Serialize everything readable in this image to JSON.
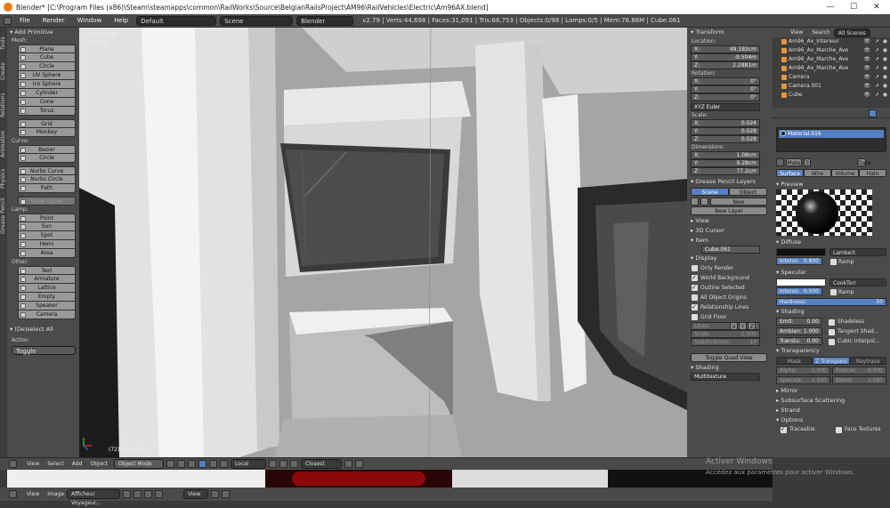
{
  "window": {
    "title": "Blender* [C:\\Program Files (x86)\\Steam\\steamapps\\common\\RailWorks\\Source\\BelgianRailsProject\\AM96\\RailVehicles\\Electric\\Am96AX.blend]",
    "minimize": "—",
    "maximize": "☐",
    "close": "✕"
  },
  "menubar": {
    "items": [
      "File",
      "Render",
      "Window",
      "Help"
    ],
    "layout": "Default",
    "scene": "Scene",
    "engine": "Blender Render",
    "stats": "v2.79 | Verts:44,698 | Faces:31,091 | Tris:68,753 | Objects:0/98 | Lamps:0/5 | Mem:76.86M | Cube.061"
  },
  "toolshelf": {
    "tabs": [
      "Tools",
      "Create",
      "Relations",
      "Animation",
      "Physics",
      "Grease Pencil"
    ],
    "panel_title": "Add Primitive",
    "sections": [
      {
        "label": "Mesh:",
        "items": [
          "Plane",
          "Cube",
          "Circle",
          "UV Sphere",
          "Ico Sphere",
          "Cylinder",
          "Cone",
          "Torus"
        ]
      },
      {
        "label": "",
        "items": [
          "Grid",
          "Monkey"
        ]
      },
      {
        "label": "Curve:",
        "items": [
          "Bezier",
          "Circle"
        ]
      },
      {
        "label": "",
        "items": [
          "Nurbs Curve",
          "Nurbs Circle",
          "Path"
        ]
      },
      {
        "label": "",
        "items": [
          "Draw Curve"
        ]
      },
      {
        "label": "Lamp:",
        "items": [
          "Point",
          "Sun",
          "Spot",
          "Hemi",
          "Area"
        ]
      },
      {
        "label": "Other:",
        "items": [
          "Text",
          "Armature",
          "Lattice",
          "Empty",
          "Speaker",
          "Camera"
        ]
      }
    ],
    "operator_title": "(De)select All",
    "action_label": "Action",
    "action_value": "Toggle"
  },
  "viewport": {
    "view_label": "User Persp",
    "units": "Meters",
    "object_label": "(72) Cube.061",
    "watermark1": "Activer Windows",
    "watermark2": "Accédez aux paramètres pour activer Windows."
  },
  "npanel": {
    "transform": "Transform",
    "location": "Location:",
    "loc": [
      [
        "X:",
        "49.183cm"
      ],
      [
        "Y:",
        "-9.504m"
      ],
      [
        "Z:",
        "2.2881m"
      ]
    ],
    "rotation": "Rotation:",
    "rot": [
      [
        "X:",
        "0°"
      ],
      [
        "Y:",
        "0°"
      ],
      [
        "Z:",
        "0°"
      ]
    ],
    "euler": "XYZ Euler",
    "scale": "Scale:",
    "scl": [
      [
        "X:",
        "0.024"
      ],
      [
        "Y:",
        "0.028"
      ],
      [
        "Z:",
        "0.028"
      ]
    ],
    "dimensions": "Dimensions:",
    "dim": [
      [
        "X:",
        "1.08cm"
      ],
      [
        "Y:",
        "9.28cm"
      ],
      [
        "Z:",
        "77.2cm"
      ]
    ],
    "grease": "Grease Pencil Layers",
    "gp_tabs": [
      "Scene",
      "Object"
    ],
    "new": "New",
    "new_layer": "New Layer",
    "view": "View",
    "cursor": "3D Cursor",
    "item": "Item",
    "item_name": "Cube.061",
    "display": "Display",
    "checks": [
      [
        "Only Render",
        false
      ],
      [
        "World Background",
        true
      ],
      [
        "Outline Selected",
        true
      ],
      [
        "All Object Origins",
        false
      ],
      [
        "Relationship Lines",
        true
      ]
    ],
    "grid_floor": "Grid Floor",
    "axes": [
      "X",
      "Y",
      "Z"
    ],
    "lines": [
      "Lines:",
      "16"
    ],
    "scale_f": [
      "Scale:",
      "1.000"
    ],
    "subdiv": [
      "Subdivisions:",
      "10"
    ],
    "toggle_quad": "Toggle Quad View",
    "shading": "Shading",
    "shading_mode": "Multitexture"
  },
  "outliner": {
    "tabs": [
      "View",
      "Search",
      "All Scenes"
    ],
    "items": [
      "Am96_Ax_Interieur",
      "Am96_Ax_Marche_Ave",
      "Am96_Ax_Marche_Ave",
      "Am96_Ax_Marche_Ave",
      "Camera",
      "Camera.001",
      "Cube"
    ]
  },
  "props": {
    "material": "Material.016",
    "mate_label": "Mate",
    "mate_users": "3",
    "data": "Data",
    "tabs": [
      "Surface",
      "Wire",
      "Volume",
      "Halo"
    ],
    "preview": "Preview",
    "diffuse": "Diffuse",
    "diffuse_shader": "Lambert",
    "intensity": [
      "Intensi:",
      "0.800"
    ],
    "ramp": "Ramp",
    "specular": "Specular",
    "spec_shader": "CookTorr",
    "spec_int": [
      "Intensi:",
      "0.500"
    ],
    "hardness": [
      "Hardness:",
      "50"
    ],
    "shading": "Shading",
    "emit": [
      "Emit:",
      "0.00"
    ],
    "ambient": [
      "Ambien:",
      "1.000"
    ],
    "translu": [
      "Translu:",
      "0.00"
    ],
    "shadeless": "Shadeless",
    "tangent": "Tangent Shad...",
    "cubic": "Cubic Interpol...",
    "transparency": "Transparency",
    "trans_tabs": [
      "Mask",
      "Z Transpare",
      "Raytrace"
    ],
    "alpha": [
      "Alpha:",
      "1.000"
    ],
    "fresnel": [
      "Fresnel:",
      "0.000"
    ],
    "specul": [
      "Specula:",
      "1.000"
    ],
    "blend": [
      "Blend:",
      "1.250"
    ],
    "mirror": "Mirror",
    "sss": "Subsurface Scattering",
    "strand": "Strand",
    "options": "Options",
    "traceable": "Traceable",
    "face_tex": "Face Textures"
  },
  "vheader": {
    "view": "View",
    "select": "Select",
    "add": "Add",
    "object": "Object",
    "mode": "Object Mode",
    "pivot": "Local",
    "snap": "Closest"
  },
  "bheader": {
    "view": "View",
    "image": "Image",
    "image_name": "Afficheur Voyageur...",
    "view2": "View"
  }
}
